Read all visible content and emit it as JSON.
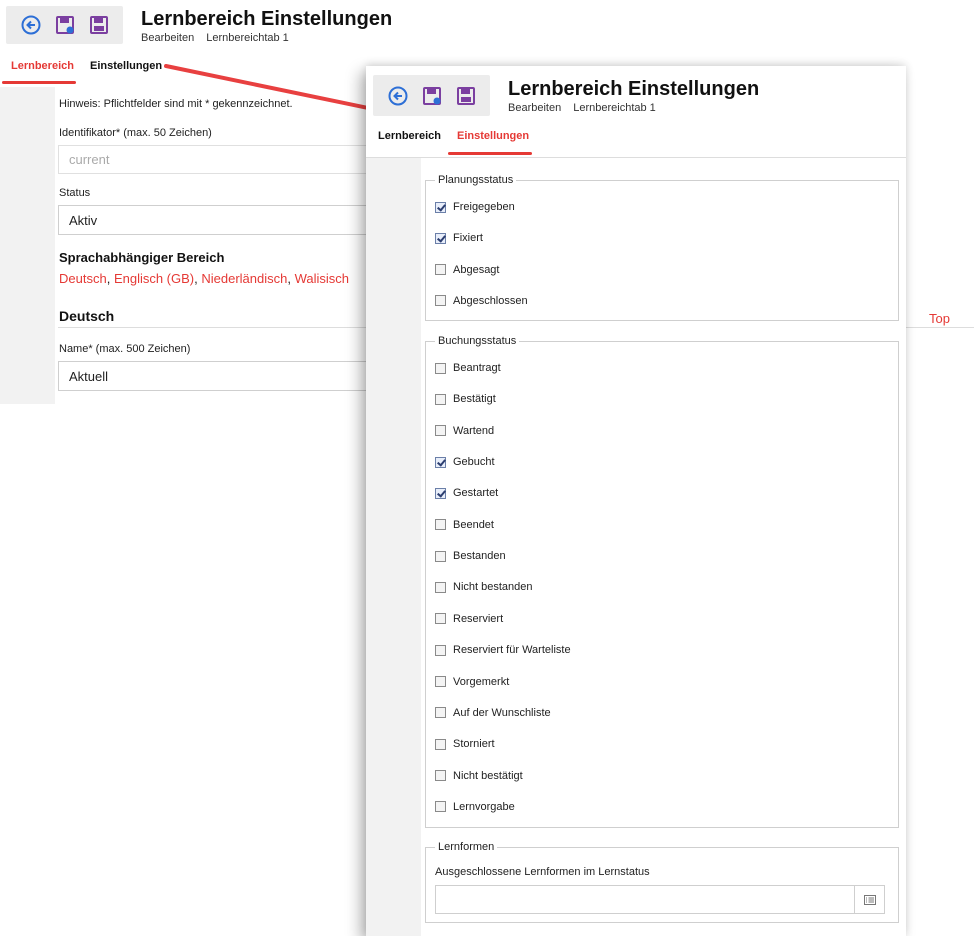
{
  "background_page": {
    "toolbar": {
      "back_icon": "back-arrow-icon",
      "save_new_icon": "save-new-icon",
      "save_icon": "save-icon"
    },
    "title": "Lernbereich Einstellungen",
    "breadcrumb": [
      "Bearbeiten",
      "Lernbereichtab 1"
    ],
    "tabs": [
      {
        "label": "Lernbereich",
        "active": true
      },
      {
        "label": "Einstellungen",
        "active": false
      }
    ],
    "hint": "Hinweis: Pflichtfelder sind mit * gekennzeichnet.",
    "identifier": {
      "label": "Identifikator* (max. 50 Zeichen)",
      "value": "current"
    },
    "status": {
      "label": "Status",
      "value": "Aktiv"
    },
    "language_section": {
      "heading": "Sprachabhängiger Bereich",
      "languages": [
        "Deutsch",
        "Englisch (GB)",
        "Niederländisch",
        "Walisisch"
      ],
      "separator": ", "
    },
    "deutsch_heading": "Deutsch",
    "name": {
      "label": "Name* (max. 500 Zeichen)",
      "value": "Aktuell"
    },
    "top_link": "Top"
  },
  "overlay_page": {
    "title": "Lernbereich Einstellungen",
    "breadcrumb": [
      "Bearbeiten",
      "Lernbereichtab 1"
    ],
    "tabs": [
      {
        "label": "Lernbereich",
        "active": false
      },
      {
        "label": "Einstellungen",
        "active": true
      }
    ],
    "planungsstatus": {
      "legend": "Planungsstatus",
      "items": [
        {
          "label": "Freigegeben",
          "checked": true
        },
        {
          "label": "Fixiert",
          "checked": true
        },
        {
          "label": "Abgesagt",
          "checked": false
        },
        {
          "label": "Abgeschlossen",
          "checked": false
        }
      ]
    },
    "buchungsstatus": {
      "legend": "Buchungsstatus",
      "items": [
        {
          "label": "Beantragt",
          "checked": false
        },
        {
          "label": "Bestätigt",
          "checked": false
        },
        {
          "label": "Wartend",
          "checked": false
        },
        {
          "label": "Gebucht",
          "checked": true
        },
        {
          "label": "Gestartet",
          "checked": true
        },
        {
          "label": "Beendet",
          "checked": false
        },
        {
          "label": "Bestanden",
          "checked": false
        },
        {
          "label": "Nicht bestanden",
          "checked": false
        },
        {
          "label": "Reserviert",
          "checked": false
        },
        {
          "label": "Reserviert für Warteliste",
          "checked": false
        },
        {
          "label": "Vorgemerkt",
          "checked": false
        },
        {
          "label": "Auf der Wunschliste",
          "checked": false
        },
        {
          "label": "Storniert",
          "checked": false
        },
        {
          "label": "Nicht bestätigt",
          "checked": false
        },
        {
          "label": "Lernvorgabe",
          "checked": false
        }
      ]
    },
    "lernformen": {
      "legend": "Lernformen",
      "field_label": "Ausgeschlossene Lernformen im Lernstatus",
      "value": "",
      "picker_icon": "list-picker-icon"
    }
  },
  "colors": {
    "accent": "#e53935",
    "icon_blue": "#2d6fd6",
    "icon_purple": "#7b3fa0"
  }
}
